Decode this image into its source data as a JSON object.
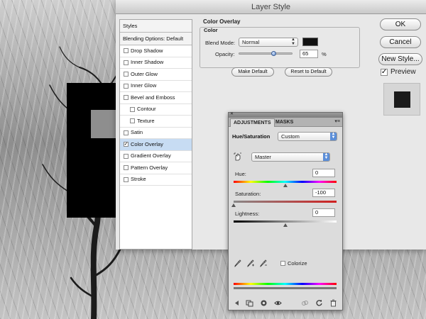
{
  "dialog": {
    "title": "Layer Style",
    "styles_header": "Styles",
    "blending_options": "Blending Options: Default",
    "style_items": [
      {
        "label": "Drop Shadow",
        "checked": false,
        "indent": false,
        "active": false
      },
      {
        "label": "Inner Shadow",
        "checked": false,
        "indent": false,
        "active": false
      },
      {
        "label": "Outer Glow",
        "checked": false,
        "indent": false,
        "active": false
      },
      {
        "label": "Inner Glow",
        "checked": false,
        "indent": false,
        "active": false
      },
      {
        "label": "Bevel and Emboss",
        "checked": false,
        "indent": false,
        "active": false
      },
      {
        "label": "Contour",
        "checked": false,
        "indent": true,
        "active": false
      },
      {
        "label": "Texture",
        "checked": false,
        "indent": true,
        "active": false
      },
      {
        "label": "Satin",
        "checked": false,
        "indent": false,
        "active": false
      },
      {
        "label": "Color Overlay",
        "checked": true,
        "indent": false,
        "active": true
      },
      {
        "label": "Gradient Overlay",
        "checked": false,
        "indent": false,
        "active": false
      },
      {
        "label": "Pattern Overlay",
        "checked": false,
        "indent": false,
        "active": false
      },
      {
        "label": "Stroke",
        "checked": false,
        "indent": false,
        "active": false
      }
    ],
    "group_title": "Color Overlay",
    "sub_title": "Color",
    "blend_mode_label": "Blend Mode:",
    "blend_mode_value": "Normal",
    "overlay_color": "#111111",
    "opacity_label": "Opacity:",
    "opacity_value": "65",
    "opacity_unit": "%",
    "opacity_level": 0.65,
    "make_default": "Make Default",
    "reset_default": "Reset to Default",
    "ok": "OK",
    "cancel": "Cancel",
    "new_style": "New Style...",
    "preview_label": "Preview",
    "preview_checked": true
  },
  "adjustments": {
    "tab_adjustments": "ADJUSTMENTS",
    "tab_masks": "MASKS",
    "heading": "Hue/Saturation",
    "preset": "Custom",
    "channel": "Master",
    "hue_label": "Hue:",
    "hue_value": "0",
    "saturation_label": "Saturation:",
    "saturation_value": "-100",
    "lightness_label": "Lightness:",
    "lightness_value": "0",
    "colorize_label": "Colorize",
    "colorize_checked": false
  },
  "colors": {
    "accent": "#5b8ed8",
    "selection": "#c7dcf3"
  }
}
